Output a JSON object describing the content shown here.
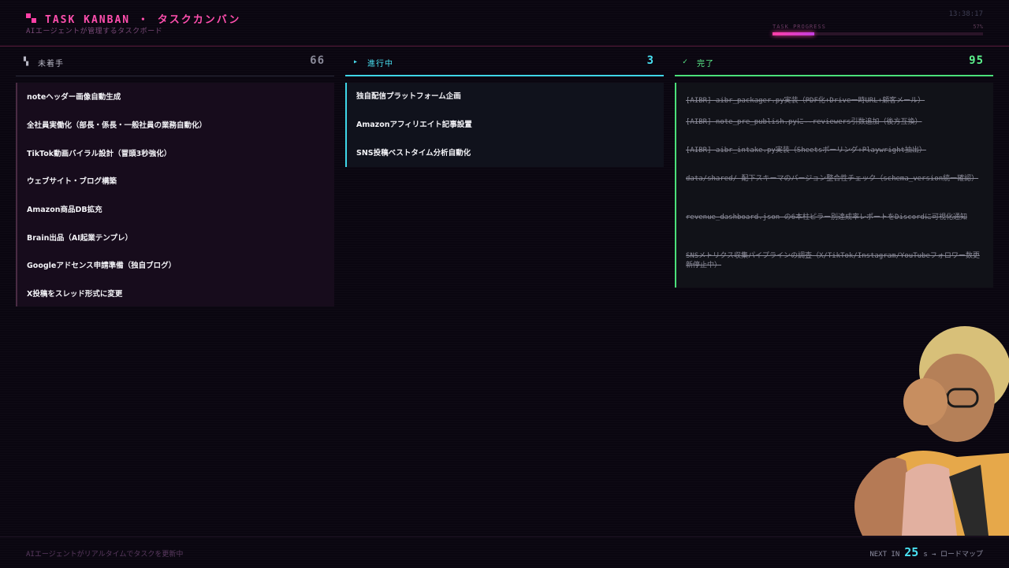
{
  "header": {
    "title": "TASK KANBAN ・ タスクカンバン",
    "subtitle": "AIエージェントが管理するタスクボード",
    "clock": "13:38:17",
    "progress_label": "TASK PROGRESS",
    "progress_percent": "57%",
    "progress_value": 0.57
  },
  "columns": {
    "todo": {
      "icon": "todo-squares-icon",
      "name": "未着手",
      "count": "66",
      "cards": [
        "noteヘッダー画像自動生成",
        "全社員実働化（部長・係長・一般社員の業務自動化）",
        "TikTok動画バイラル設計（冒頭3秒強化）",
        "ウェブサイト・ブログ構築",
        "Amazon商品DB拡充",
        "Brain出品（AI起業テンプレ）",
        "Googleアドセンス申請準備（独自ブログ）",
        "X投稿をスレッド形式に変更"
      ]
    },
    "in_progress": {
      "icon": "play-triangle-icon",
      "name": "進行中",
      "count": "3",
      "cards": [
        "独自配信プラットフォーム企画",
        "Amazonアフィリエイト記事設置",
        "SNS投稿ベストタイム分析自動化"
      ]
    },
    "done": {
      "icon": "check-icon",
      "name": "完了",
      "count": "95",
      "cards": [
        "[AIBR] aibr_packager.py実装（PDF化+Drive一時URL+顧客メール）",
        "[AIBR] note_pre_publish.pyに--reviewers引数追加（後方互換）",
        "[AIBR] aibr_intake.py実装（Sheetsポーリング+Playwright抽出）",
        "data/shared/ 配下スキーマのバージョン整合性チェック（schema_version統一確認）",
        "revenue_dashboard.json の6本柱ピラー別達成率レポートをDiscordに可視化通知",
        "SNSメトリクス収集パイプラインの調査（X/TikTok/Instagram/YouTubeフォロワー数更新停止中）"
      ]
    }
  },
  "footer": {
    "status": "AIエージェントがリアルタイムでタスクを更新中",
    "next_label": "NEXT IN",
    "next_seconds": "25",
    "next_suffix": "s → ロードマップ"
  },
  "colors": {
    "accent_pink": "#ff3fa6",
    "in_progress_cyan": "#3fd6e8",
    "done_green": "#4be07a"
  }
}
